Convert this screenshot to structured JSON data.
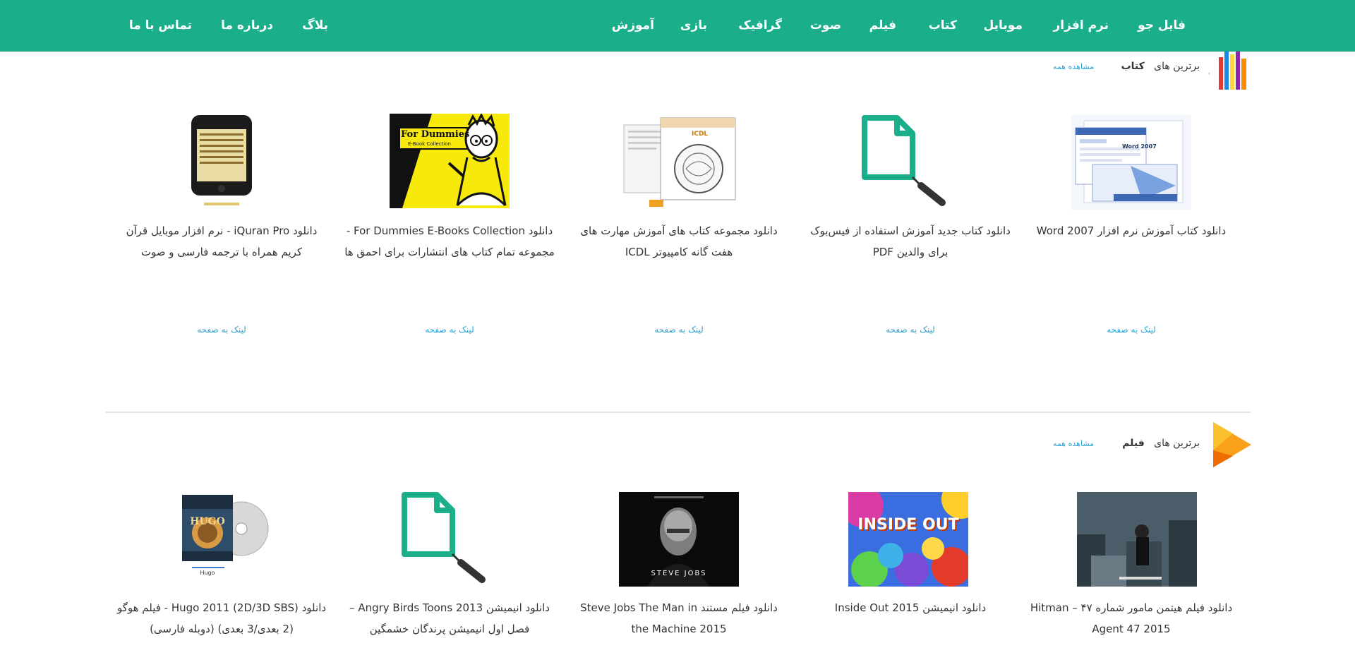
{
  "nav": {
    "items": [
      {
        "label": "فایل جو"
      },
      {
        "label": "نرم افزار"
      },
      {
        "label": "موبایل"
      },
      {
        "label": "کتاب"
      },
      {
        "label": "فیلم"
      },
      {
        "label": "صوت"
      },
      {
        "label": "گرافیک"
      },
      {
        "label": "بازی"
      },
      {
        "label": "آموزش"
      }
    ],
    "secondary": [
      {
        "label": "بلاگ"
      },
      {
        "label": "درباره ما"
      },
      {
        "label": "تماس با ما"
      }
    ]
  },
  "books": {
    "title": "برترین های",
    "category": "کتاب",
    "see_all": "مشاهده همه",
    "items": [
      {
        "title": "دانلود کتاب آموزش نرم افزار Word 2007",
        "link": "لینک به صفحه",
        "thumb": "word-2007-cover"
      },
      {
        "title": "دانلود کتاب جدید آموزش استفاده از فیس‌بوک برای والدین PDF",
        "link": "لینک به صفحه",
        "thumb": "no-image-placeholder"
      },
      {
        "title": "دانلود مجموعه کتاب های آموزش مهارت های هفت گانه کامپیوتر ICDL",
        "link": "لینک به صفحه",
        "thumb": "icdl-cover"
      },
      {
        "title": "دانلود For Dummies E-Books Collection - مجموعه تمام کتاب های انتشارات برای احمق ها",
        "link": "لینک به صفحه",
        "thumb": "for-dummies-cover"
      },
      {
        "title": "دانلود iQuran Pro - نرم افزار موبایل قرآن کریم همراه با ترجمه فارسی و صوت",
        "link": "لینک به صفحه",
        "thumb": "iquran-phone"
      }
    ]
  },
  "movies": {
    "title": "برترین های",
    "category": "فیلم",
    "see_all": "مشاهده همه",
    "items": [
      {
        "title": "دانلود فیلم هیتمن مامور شماره ۴۷ – Hitman Agent 47 2015",
        "thumb": "hitman-poster"
      },
      {
        "title": "دانلود انیمیشن Inside Out 2015",
        "thumb": "inside-out-poster"
      },
      {
        "title": "دانلود فیلم مستند Steve Jobs The Man in the Machine 2015",
        "thumb": "steve-jobs-poster"
      },
      {
        "title": "دانلود انیمیشن Angry Birds Toons 2013 – فصل اول انیمیشن پرندگان خشمگین",
        "thumb": "no-image-placeholder"
      },
      {
        "title": "دانلود Hugo 2011 (2D/3D SBS) - فیلم هوگو (2 بعدی/3 بعدی) (دوبله فارسی)",
        "thumb": "hugo-dvd"
      }
    ]
  },
  "poster_text": {
    "dummies": "For Dummies",
    "dummies_sub": "E-Book Collection",
    "word": "Word 2007",
    "icdl": "ICDL",
    "inside_out": "INSIDE OUT",
    "steve_jobs": "STEVE JOBS",
    "hugo": "HUGO",
    "hugo_label": "Hugo"
  },
  "colors": {
    "nav_bg": "#1aae8b",
    "link": "#2aa4d6",
    "placeholder": "#1aae8b"
  }
}
